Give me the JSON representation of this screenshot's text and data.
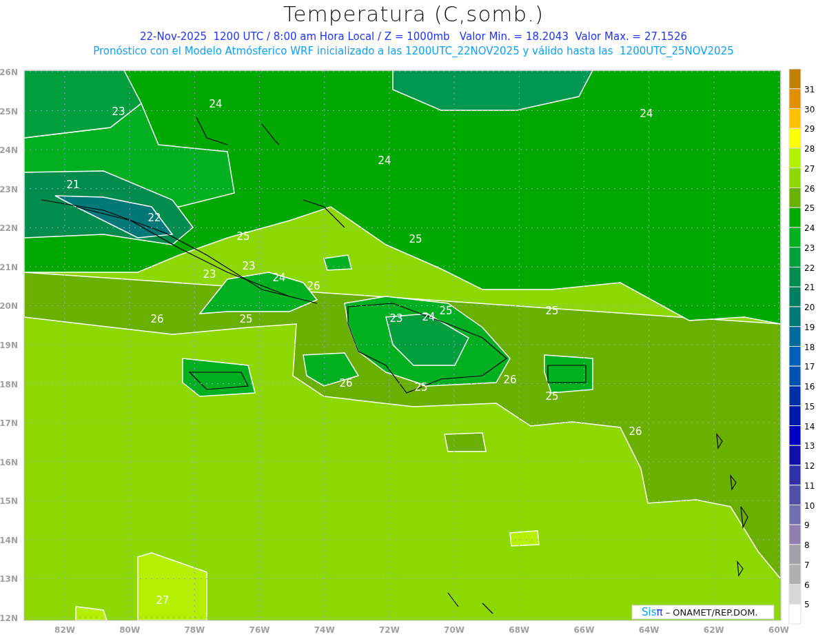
{
  "title": "Temperatura (C,somb.)",
  "subtitle": "22-Nov-2025  1200 UTC / 8:00 am Hora Local / Z = 1000mb   Valor Min. = 18.2043  Valor Max. = 27.1526",
  "description": "Pronóstico con el Modelo Atmósferico WRF inicializado a las 1200UTC_22NOV2025 y válido hasta las  1200UTC_25NOV2025",
  "y_axis": [
    "26N",
    "25N",
    "24N",
    "23N",
    "22N",
    "21N",
    "20N",
    "19N",
    "18N",
    "17N",
    "16N",
    "15N",
    "14N",
    "13N",
    "12N"
  ],
  "x_axis": [
    "82W",
    "80W",
    "78W",
    "76W",
    "74W",
    "72W",
    "70W",
    "68W",
    "66W",
    "64W",
    "62W",
    "60W"
  ],
  "contour_labels": [
    {
      "text": "23"
    },
    {
      "text": "24"
    },
    {
      "text": "24"
    },
    {
      "text": "24"
    },
    {
      "text": "21"
    },
    {
      "text": "22"
    },
    {
      "text": "25"
    },
    {
      "text": "25"
    },
    {
      "text": "23"
    },
    {
      "text": "23"
    },
    {
      "text": "24"
    },
    {
      "text": "26"
    },
    {
      "text": "26"
    },
    {
      "text": "25"
    },
    {
      "text": "23"
    },
    {
      "text": "24"
    },
    {
      "text": "25"
    },
    {
      "text": "25"
    },
    {
      "text": "26"
    },
    {
      "text": "25"
    },
    {
      "text": "26"
    },
    {
      "text": "25"
    },
    {
      "text": "26"
    },
    {
      "text": "27"
    }
  ],
  "legend": {
    "boxes": [
      {
        "color": "#bf7f00"
      },
      {
        "color": "#e09000"
      },
      {
        "color": "#ffc000"
      },
      {
        "color": "#ffff00"
      },
      {
        "color": "#b4f000"
      },
      {
        "color": "#8cd800"
      },
      {
        "color": "#6ab000"
      },
      {
        "color": "#00a800"
      },
      {
        "color": "#00b020"
      },
      {
        "color": "#009e3c"
      },
      {
        "color": "#008c4c"
      },
      {
        "color": "#008060"
      },
      {
        "color": "#007878"
      },
      {
        "color": "#006a9a"
      },
      {
        "color": "#0060b8"
      },
      {
        "color": "#0050b0"
      },
      {
        "color": "#0030a8"
      },
      {
        "color": "#0018a8"
      },
      {
        "color": "#0000c0"
      },
      {
        "color": "#1010a8"
      },
      {
        "color": "#3030a8"
      },
      {
        "color": "#5050a8"
      },
      {
        "color": "#7070b0"
      },
      {
        "color": "#9080b0"
      },
      {
        "color": "#a0a0a8"
      },
      {
        "color": "#b0b0b0"
      },
      {
        "color": "#d8d8d8"
      },
      {
        "color": "#ffffff"
      }
    ],
    "labels": [
      "31",
      "30",
      "29",
      "28",
      "27",
      "26",
      "25",
      "24",
      "23",
      "22",
      "21",
      "20",
      "19",
      "18",
      "17",
      "16",
      "15",
      "14",
      "13",
      "12",
      "11",
      "10",
      "9",
      "8",
      "7",
      "6",
      "5"
    ]
  },
  "credit": {
    "brand": "Sis",
    "brand_symbol": "π",
    "text": "– ONAMET/REP.DOM."
  }
}
